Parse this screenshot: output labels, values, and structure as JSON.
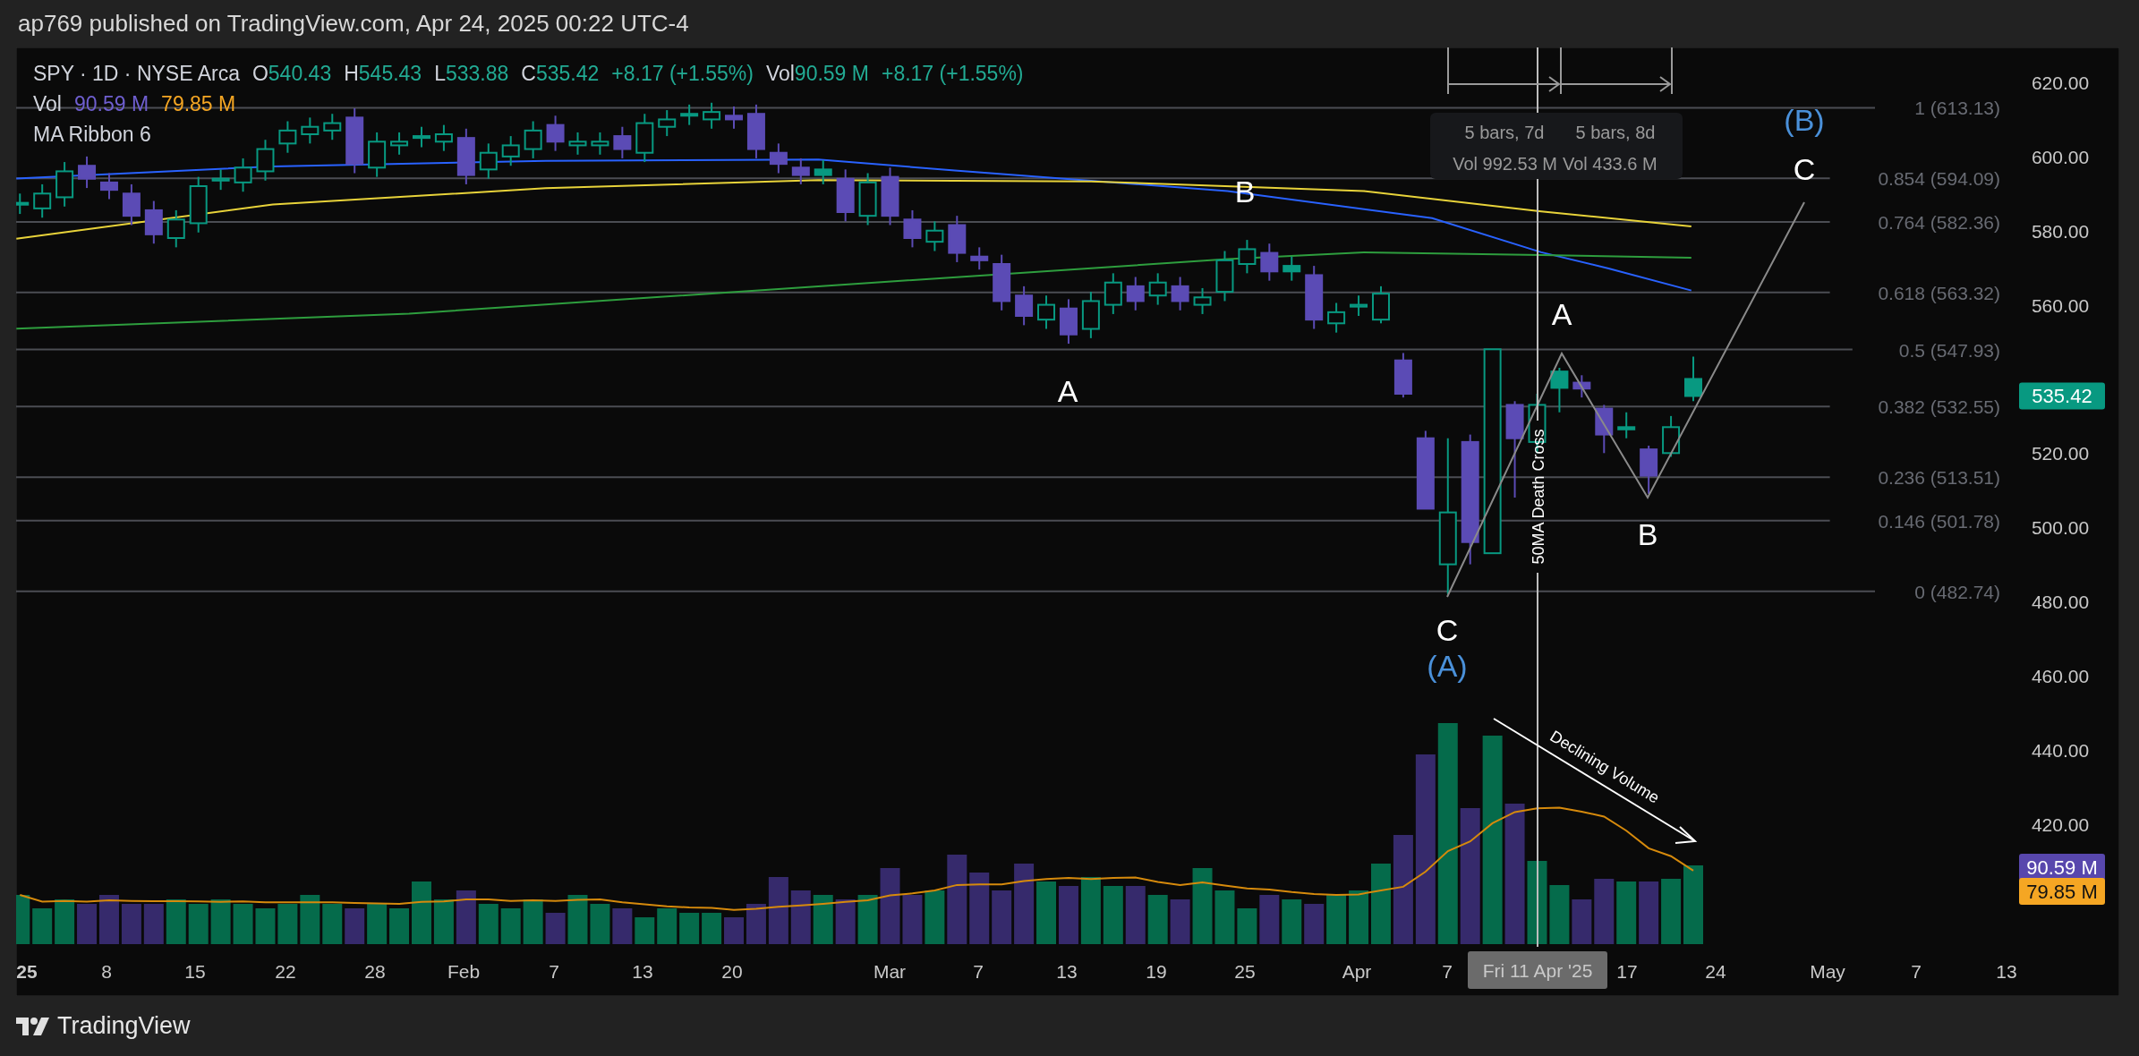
{
  "header": {
    "text": "ap769 published on TradingView.com, Apr 24, 2025 00:22 UTC-4"
  },
  "legend": {
    "symbol": "SPY · 1D · NYSE Arca",
    "ohlc": [
      {
        "label": "O",
        "value": "540.43"
      },
      {
        "label": "H",
        "value": "545.43"
      },
      {
        "label": "L",
        "value": "533.88"
      },
      {
        "label": "C",
        "value": "535.42"
      }
    ],
    "change": "+8.17 (+1.55%)",
    "volume": {
      "label": "Vol",
      "value": "90.59 M",
      "change": "+8.17 (+1.55%)"
    },
    "vol_indicator": {
      "name": "Vol",
      "values": [
        {
          "text": "90.59 M",
          "color": "#6f5fd0"
        },
        {
          "text": "79.85 M",
          "color": "#f5a623"
        }
      ]
    },
    "ma_ribbon": {
      "name": "MA Ribbon 6"
    }
  },
  "measure": [
    {
      "bars": "5 bars, 7d",
      "volume": "Vol 992.53 M"
    },
    {
      "bars": "5 bars, 8d",
      "volume": "Vol 433.6 M"
    }
  ],
  "fib_levels": [
    "1 (613.13)",
    "0.854 (594.09)",
    "0.764 (582.36)",
    "0.618 (563.32)",
    "0.5 (547.93)",
    "0.382 (532.55)",
    "0.236 (513.51)",
    "0.146 (501.78)",
    "0 (482.74)"
  ],
  "wave_labels": [
    {
      "text": "(B)",
      "kind": "major"
    },
    {
      "text": "C",
      "kind": "minor"
    },
    {
      "text": "B",
      "kind": "minor"
    },
    {
      "text": "A",
      "kind": "minor"
    },
    {
      "text": "A",
      "kind": "minor"
    },
    {
      "text": "B",
      "kind": "minor"
    },
    {
      "text": "C",
      "kind": "minor"
    },
    {
      "text": "(A)",
      "kind": "major"
    }
  ],
  "crosshair": {
    "note": "50MA Death Cross",
    "date_label": "Fri 11 Apr '25"
  },
  "annotation": {
    "text": "Declining Volume"
  },
  "price_axis": [
    "620.00",
    "600.00",
    "580.00",
    "560.00",
    "520.00",
    "500.00",
    "480.00",
    "460.00",
    "440.00",
    "420.00"
  ],
  "price_tags": [
    {
      "text": "535.42",
      "color": "#089981"
    },
    {
      "text": "90.59 M",
      "color": "#5847ad"
    },
    {
      "text": "79.85 M",
      "color": "#f5a623"
    }
  ],
  "time_axis": [
    {
      "label": "25",
      "kind": "year"
    },
    {
      "label": "8",
      "kind": "day"
    },
    {
      "label": "15",
      "kind": "day"
    },
    {
      "label": "22",
      "kind": "day"
    },
    {
      "label": "28",
      "kind": "day"
    },
    {
      "label": "Feb",
      "kind": "month"
    },
    {
      "label": "7",
      "kind": "day"
    },
    {
      "label": "13",
      "kind": "day"
    },
    {
      "label": "20",
      "kind": "day"
    },
    {
      "label": "Mar",
      "kind": "month"
    },
    {
      "label": "7",
      "kind": "day"
    },
    {
      "label": "13",
      "kind": "day"
    },
    {
      "label": "19",
      "kind": "day"
    },
    {
      "label": "25",
      "kind": "day"
    },
    {
      "label": "Apr",
      "kind": "month"
    },
    {
      "label": "7",
      "kind": "day"
    },
    {
      "label": "17",
      "kind": "day"
    },
    {
      "label": "24",
      "kind": "day"
    },
    {
      "label": "May",
      "kind": "month"
    },
    {
      "label": "7",
      "kind": "day"
    },
    {
      "label": "13",
      "kind": "day"
    }
  ],
  "footer": {
    "brand": "TradingView"
  }
}
